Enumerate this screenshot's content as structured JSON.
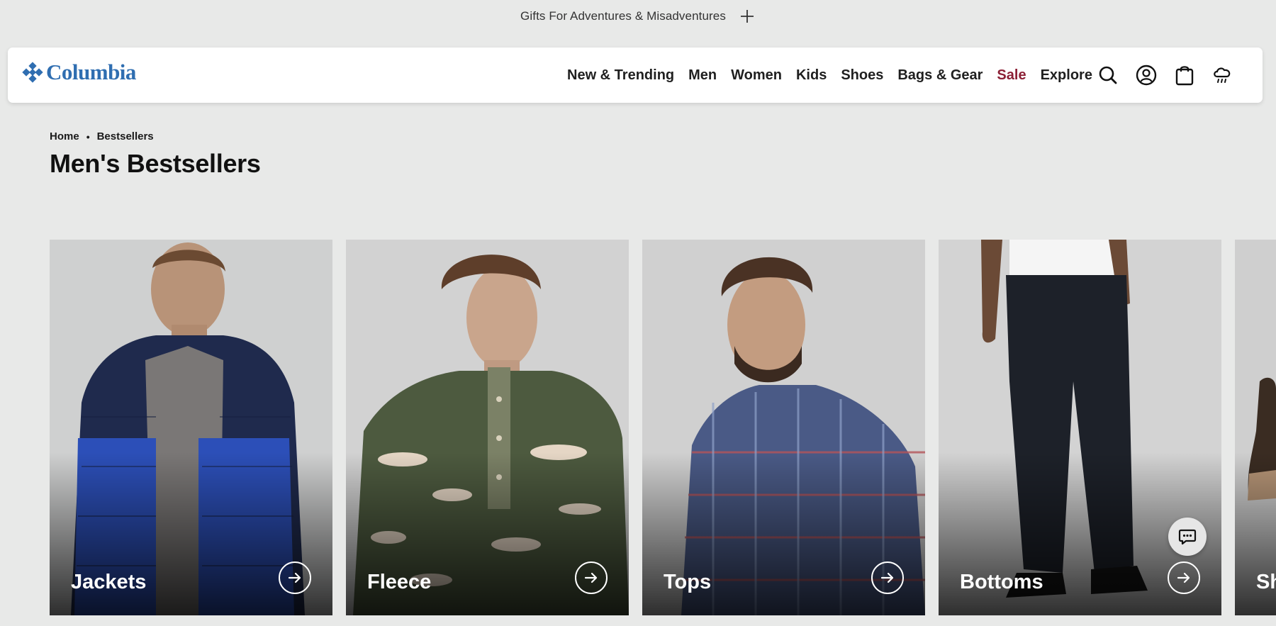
{
  "promo": {
    "text": "Gifts For Adventures & Misadventures",
    "expand_icon": "plus-icon"
  },
  "header": {
    "brand": "Columbia",
    "nav": [
      {
        "label": "New & Trending"
      },
      {
        "label": "Men"
      },
      {
        "label": "Women"
      },
      {
        "label": "Kids"
      },
      {
        "label": "Shoes"
      },
      {
        "label": "Bags & Gear"
      },
      {
        "label": "Sale",
        "color": "#8c2036"
      },
      {
        "label": "Explore"
      }
    ],
    "icons": [
      "search-icon",
      "account-icon",
      "cart-icon",
      "weather-icon"
    ]
  },
  "breadcrumb": {
    "items": [
      "Home",
      "Bestsellers"
    ],
    "separator": "•"
  },
  "page": {
    "title": "Men's Bestsellers"
  },
  "categories": [
    {
      "label": "Jackets"
    },
    {
      "label": "Fleece"
    },
    {
      "label": "Tops"
    },
    {
      "label": "Bottoms"
    },
    {
      "label": "Sh"
    }
  ],
  "chat": {
    "icon": "chat-icon"
  },
  "colors": {
    "brand": "#2f6eb1",
    "sale": "#8c2036",
    "background": "#e8e9e8"
  }
}
